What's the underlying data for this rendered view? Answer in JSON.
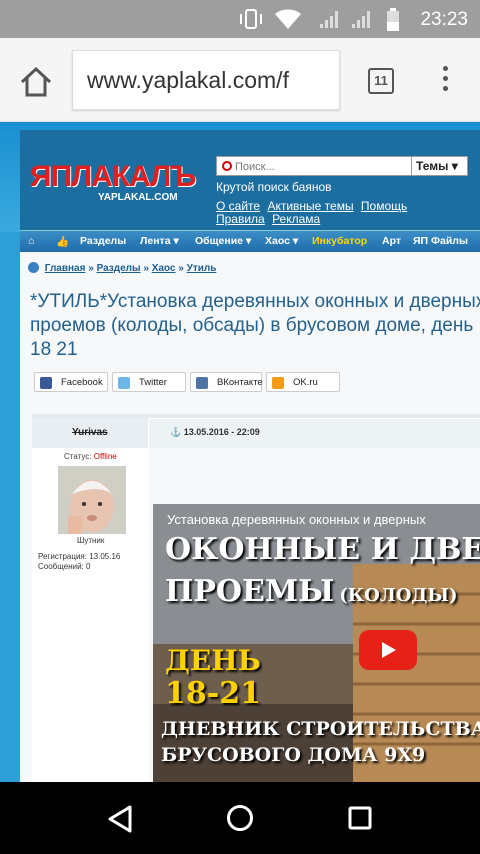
{
  "statusbar": {
    "time": "23:23"
  },
  "browser": {
    "url": "www.yaplakal.com/f",
    "tabs_count": "11"
  },
  "site": {
    "logo": "ЯПЛАКАЛЪ",
    "logo_sub": "YAPLAKAL.COM",
    "search_placeholder": "Поиск...",
    "search_scope": "Темы",
    "tagline": "Крутой поиск баянов",
    "links_row1": [
      "О сайте",
      "Активные темы",
      "Помощь"
    ],
    "links_row2": [
      "Правила",
      "Реклама"
    ]
  },
  "nav": {
    "items": [
      "Разделы",
      "Лента",
      "Общение",
      "Хаос",
      "Инкубатор",
      "Арт",
      "ЯП Файлы"
    ]
  },
  "breadcrumb": [
    "Главная",
    "Разделы",
    "Хаос",
    "Утиль"
  ],
  "topic": {
    "title": "*УТИЛЬ*Установка деревянных оконных и дверных проемов (колоды, обсады) в брусовом доме, день 18 21"
  },
  "share": [
    "Facebook",
    "Twitter",
    "ВКонтакте",
    "OK.ru"
  ],
  "post": {
    "author": "Yurivas",
    "status_label": "Статус:",
    "status_value": "Offline",
    "rank": "Шутник",
    "registration": "Регистрация: 13.05.16",
    "messages": "Сообщений: 0",
    "date": "13.05.2016 - 22:09"
  },
  "video": {
    "caption": "Установка деревянных оконных и дверных",
    "line1": "ОКОННЫЕ И ДВЕ",
    "line2": "ПРОЕМЫ",
    "line2b": "(КОЛОДЫ)",
    "line3": "ДЕНЬ",
    "line4": "18-21",
    "line5": "ДНЕВНИК СТРОИТЕЛЬСТВА",
    "line6": "БРУСОВОГО ДОМА 9Х9"
  },
  "colors": {
    "accent": "#1d6ea0",
    "link": "#24618e",
    "incubator": "#ffd800"
  }
}
